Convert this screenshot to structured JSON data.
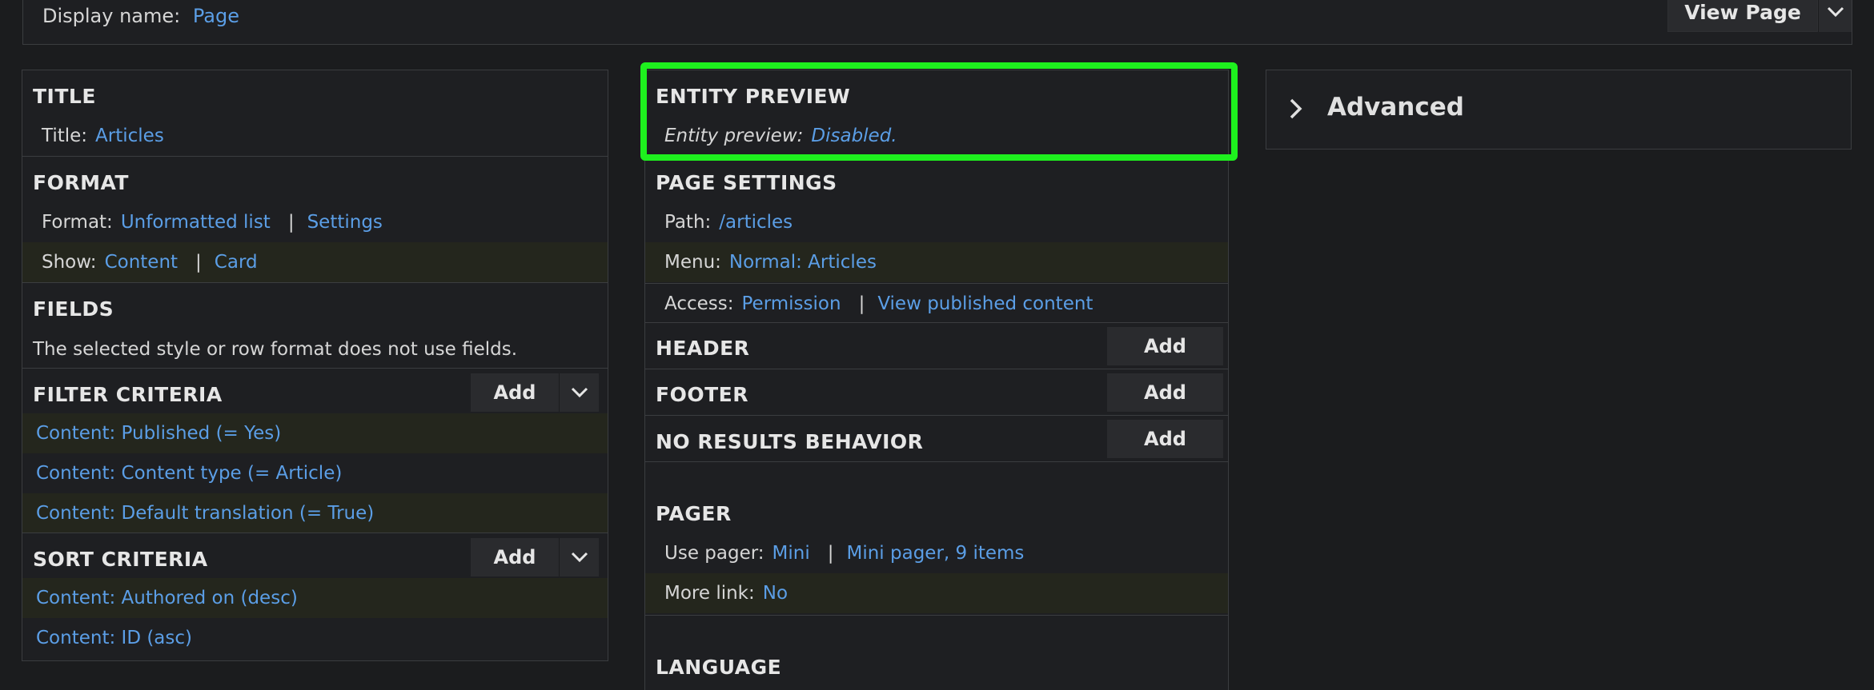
{
  "display": {
    "label": "Display name:",
    "value": "Page",
    "view_page": "View Page"
  },
  "left": {
    "title_heading": "TITLE",
    "title_label": "Title:",
    "title_value": "Articles",
    "format_heading": "FORMAT",
    "format_label": "Format:",
    "format_value": "Unformatted list",
    "format_sep": "|",
    "format_settings": "Settings",
    "show_label": "Show:",
    "show_value": "Content",
    "show_sep": "|",
    "show_mode": "Card",
    "fields_heading": "FIELDS",
    "fields_desc": "The selected style or row format does not use fields.",
    "filter_heading": "FILTER CRITERIA",
    "filter_add": "Add",
    "filters": [
      "Content: Published (= Yes)",
      "Content: Content type (= Article)",
      "Content: Default translation (= True)"
    ],
    "sort_heading": "SORT CRITERIA",
    "sort_add": "Add",
    "sorts": [
      "Content: Authored on (desc)",
      "Content: ID (asc)"
    ]
  },
  "middle": {
    "entity_heading": "ENTITY PREVIEW",
    "entity_label": "Entity preview:",
    "entity_value": "Disabled.",
    "page_settings_heading": "PAGE SETTINGS",
    "path_label": "Path:",
    "path_value": "/articles",
    "menu_label": "Menu:",
    "menu_value": "Normal: Articles",
    "access_label": "Access:",
    "access_value": "Permission",
    "access_sep": "|",
    "access_perm": "View published content",
    "header_heading": "HEADER",
    "header_add": "Add",
    "footer_heading": "FOOTER",
    "footer_add": "Add",
    "noresults_heading": "NO RESULTS BEHAVIOR",
    "noresults_add": "Add",
    "pager_heading": "PAGER",
    "pager_label": "Use pager:",
    "pager_value": "Mini",
    "pager_sep": "|",
    "pager_detail": "Mini pager, 9 items",
    "more_label": "More link:",
    "more_value": "No",
    "language_heading": "LANGUAGE"
  },
  "advanced": {
    "title": "Advanced"
  },
  "icons": {
    "dropdown": "chevron-down-icon",
    "expand": "chevron-right-icon"
  },
  "colors": {
    "link": "#5b9ee6",
    "highlight": "#1ef01e",
    "background": "#1b1c1e"
  }
}
